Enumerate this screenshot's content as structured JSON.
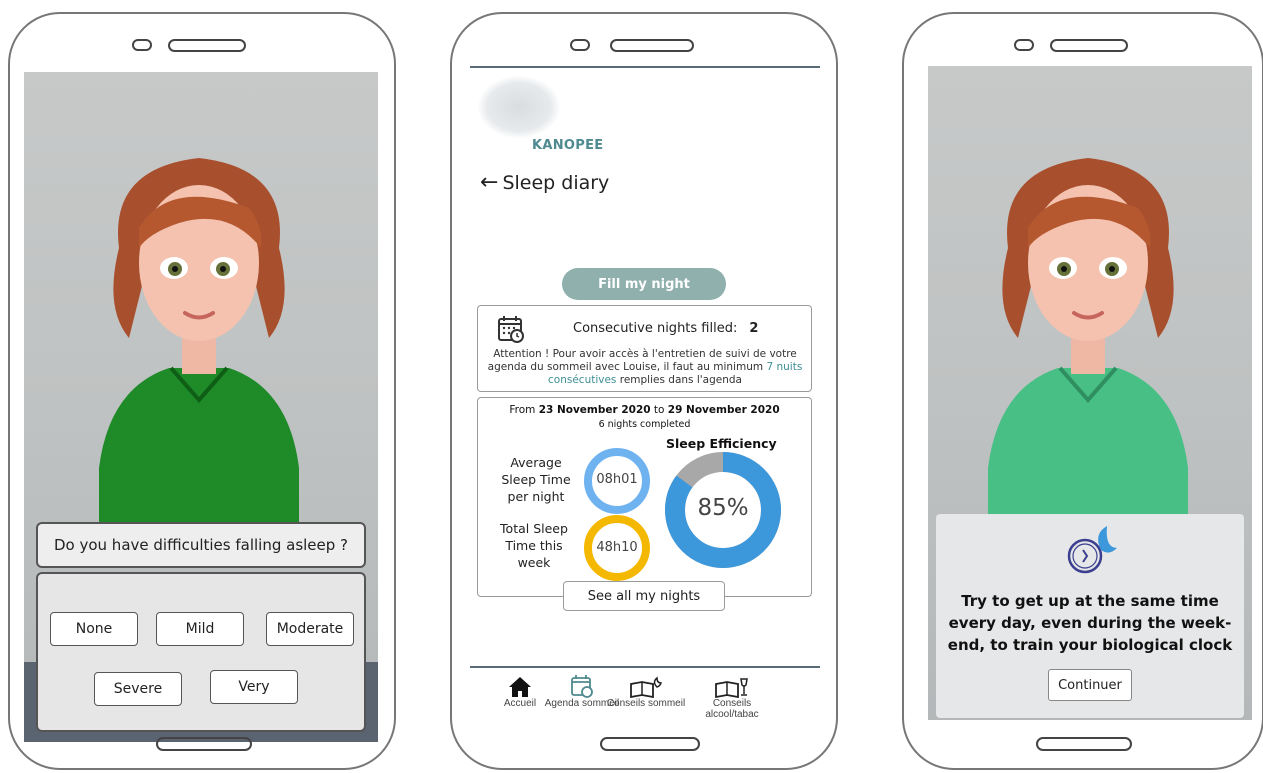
{
  "phone1": {
    "question": "Do you have difficulties falling asleep ?",
    "answers": [
      "None",
      "Mild",
      "Moderate",
      "Severe",
      "Very"
    ]
  },
  "phone2": {
    "logo": "KANOPEE",
    "title": "Sleep diary",
    "fill_button": "Fill my night",
    "consecutive_label": "Consecutive nights filled:",
    "consecutive_value": "2",
    "attention_part1": "Attention ! Pour avoir accès à l'entretien de suivi de votre agenda du sommeil avec Louise, il faut au minimum ",
    "attention_highlight": "7 nuits consécutives",
    "attention_part2": " remplies dans l'agenda",
    "range_from": "From ",
    "range_start": "23 November 2020",
    "range_to": " to ",
    "range_end": "29 November 2020",
    "nights_completed": "6 nights completed",
    "efficiency_title": "Sleep Efficiency",
    "avg_label": "Average Sleep Time per night",
    "avg_value": "08h01",
    "total_label": "Total Sleep Time this week",
    "total_value": "48h10",
    "efficiency_value": "85%",
    "efficiency_fraction": 0.85,
    "see_all": "See all my nights",
    "nav": [
      {
        "label": "Accueil",
        "icon": "home-icon"
      },
      {
        "label": "Agenda sommeil",
        "icon": "calendar-icon"
      },
      {
        "label": "Conseils sommeil",
        "icon": "book-moon-icon"
      },
      {
        "label": "Conseils alcool/tabac",
        "icon": "book-glass-icon"
      }
    ]
  },
  "phone3": {
    "advice": "Try to get up at the same time every day, even during the week-end, to train your biological clock",
    "continue": "Continuer"
  },
  "colors": {
    "accent": "#4e8a8f",
    "fill_button": "#8fb0ad",
    "ring_blue": "#3d97db",
    "ring_light_blue": "#6fb2f0",
    "ring_yellow": "#f5b800",
    "ring_grey": "#a8a8a8"
  }
}
